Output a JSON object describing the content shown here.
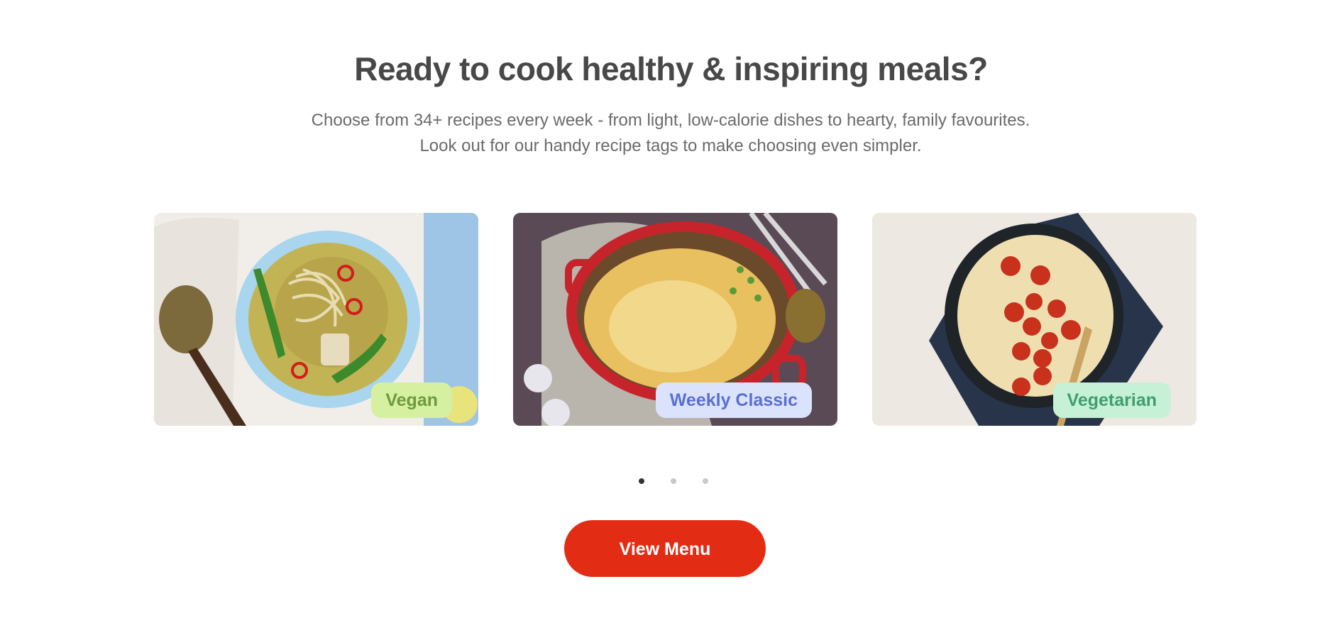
{
  "section": {
    "title": "Ready to cook healthy & inspiring meals?",
    "description": "Choose from 34+ recipes every week - from light, low-calorie dishes to hearty, family favourites. Look out for our handy recipe tags to make choosing even simpler."
  },
  "cards": [
    {
      "tag": "Vegan",
      "image": "green-curry-noodle-soup",
      "tag_color": "#d4f0a0"
    },
    {
      "tag": "Weekly Classic",
      "image": "cottage-pie",
      "tag_color": "#dbe3fc"
    },
    {
      "tag": "Vegetarian",
      "image": "tomato-risotto",
      "tag_color": "#c6f1d6"
    }
  ],
  "carousel": {
    "pages": 3,
    "active_page": 1
  },
  "cta": {
    "label": "View Menu",
    "color": "#e22d14"
  }
}
